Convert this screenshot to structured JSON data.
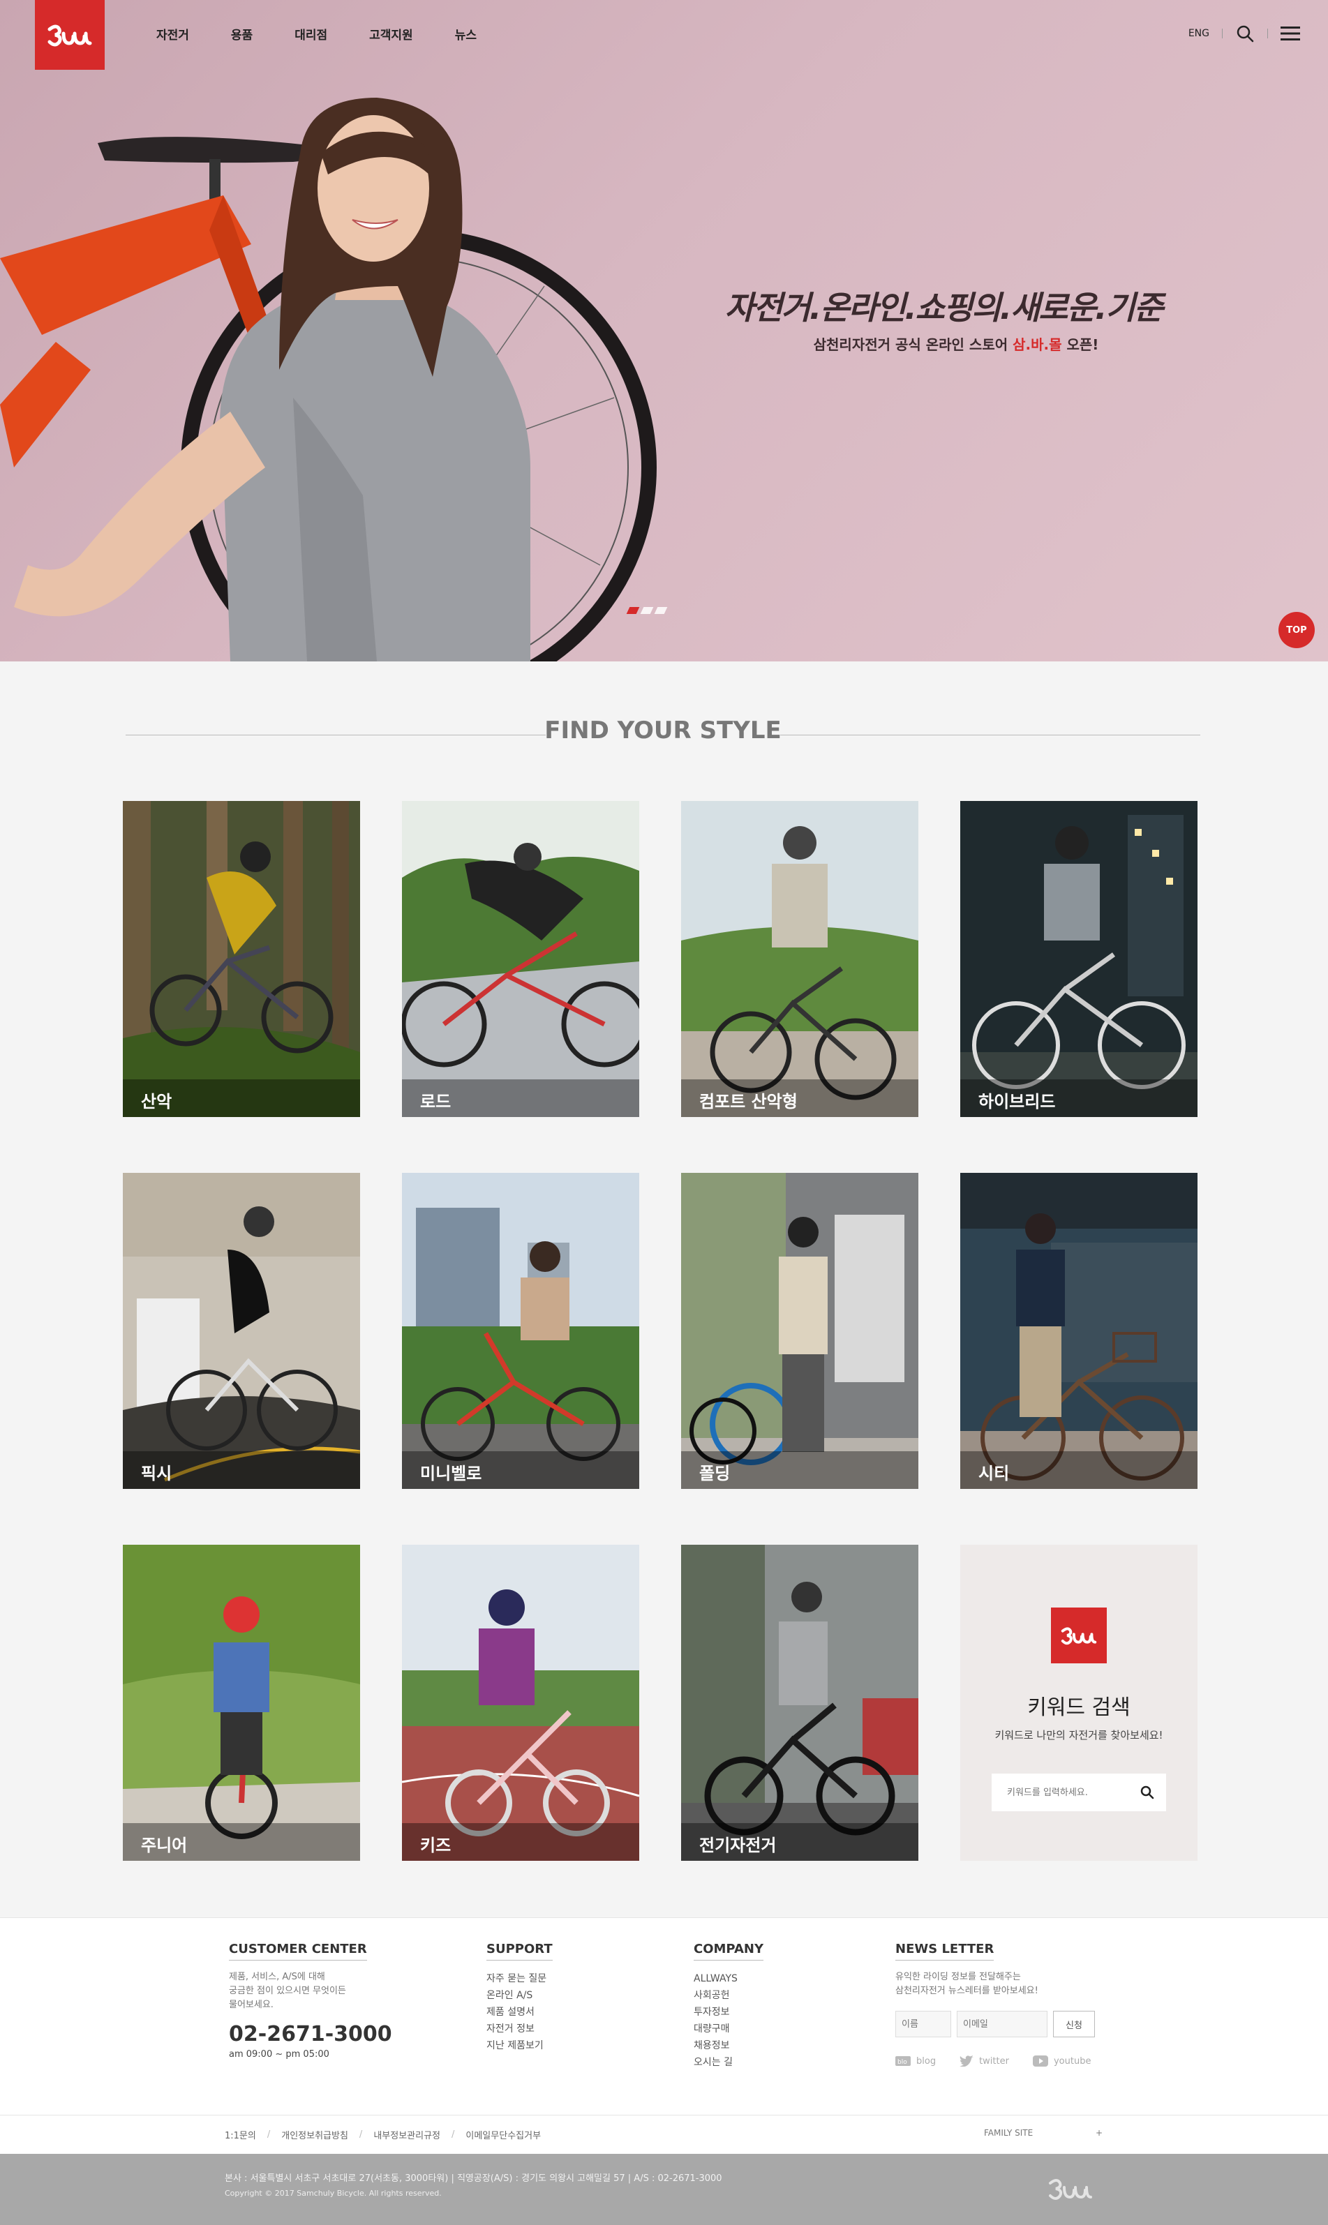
{
  "header": {
    "logo_alt": "3000",
    "nav": [
      "자전거",
      "용품",
      "대리점",
      "고객지원",
      "뉴스"
    ],
    "lang": "ENG"
  },
  "hero": {
    "headline": "자전거.온라인.쇼핑의.새로운.기준",
    "sub_prefix": "삼천리자전거 공식 온라인 스토어 ",
    "sub_highlight": "삼.바.몰",
    "sub_suffix": " 오픈!",
    "slides_total": 3,
    "slide_active": 1,
    "top_button": "TOP"
  },
  "style_section": {
    "title": "FIND YOUR STYLE",
    "cards": [
      {
        "label": "산악"
      },
      {
        "label": "로드"
      },
      {
        "label": "컴포트 산악형"
      },
      {
        "label": "하이브리드"
      },
      {
        "label": "픽시"
      },
      {
        "label": "미니벨로"
      },
      {
        "label": "폴딩"
      },
      {
        "label": "시티"
      },
      {
        "label": "주니어"
      },
      {
        "label": "키즈"
      },
      {
        "label": "전기자전거"
      }
    ],
    "keyword": {
      "title": "키워드 검색",
      "desc": "키워드로 나만의 자전거를 찾아보세요!",
      "placeholder": "키워드를 입력하세요."
    }
  },
  "footer": {
    "customer": {
      "title": "CUSTOMER CENTER",
      "desc1": "제품, 서비스, A/S에 대해",
      "desc2": "궁금한 점이 있으시면 무엇이든",
      "desc3": "물어보세요.",
      "phone": "02-2671-3000",
      "hours": "am 09:00 ~ pm 05:00"
    },
    "support": {
      "title": "SUPPORT",
      "links": [
        "자주 묻는 질문",
        "온라인 A/S",
        "제품 설명서",
        "자전거 정보",
        "지난 제품보기"
      ]
    },
    "company": {
      "title": "COMPANY",
      "links": [
        "ALLWAYS",
        "사회공헌",
        "투자정보",
        "대량구매",
        "채용정보",
        "오시는 길"
      ]
    },
    "newsletter": {
      "title": "NEWS LETTER",
      "desc1": "유익한 라이딩 정보를 전달해주는",
      "desc2": "삼천리자전거 뉴스레터를 받아보세요!",
      "name_placeholder": "이름",
      "email_placeholder": "이메일",
      "submit": "신청",
      "social": [
        "blog",
        "twitter",
        "youtube"
      ]
    },
    "legal_links": [
      "1:1문의",
      "개인정보취급방침",
      "내부정보관리규정",
      "이메일무단수집거부"
    ],
    "family_site": "FAMILY SITE",
    "family_plus": "+",
    "address": "본사 : 서울특별시 서초구 서초대로 27(서초동, 3000타워) | 직영공장(A/S) : 경기도 의왕시 고해밀길 57 | A/S : 02-2671-3000",
    "copyright": "Copyright © 2017 Samchuly Bicycle. All rights reserved."
  },
  "colors": {
    "brand_red": "#d62a2a",
    "hero_bg": "#d7b7c1",
    "footer_bottom": "#a8a8a8"
  }
}
